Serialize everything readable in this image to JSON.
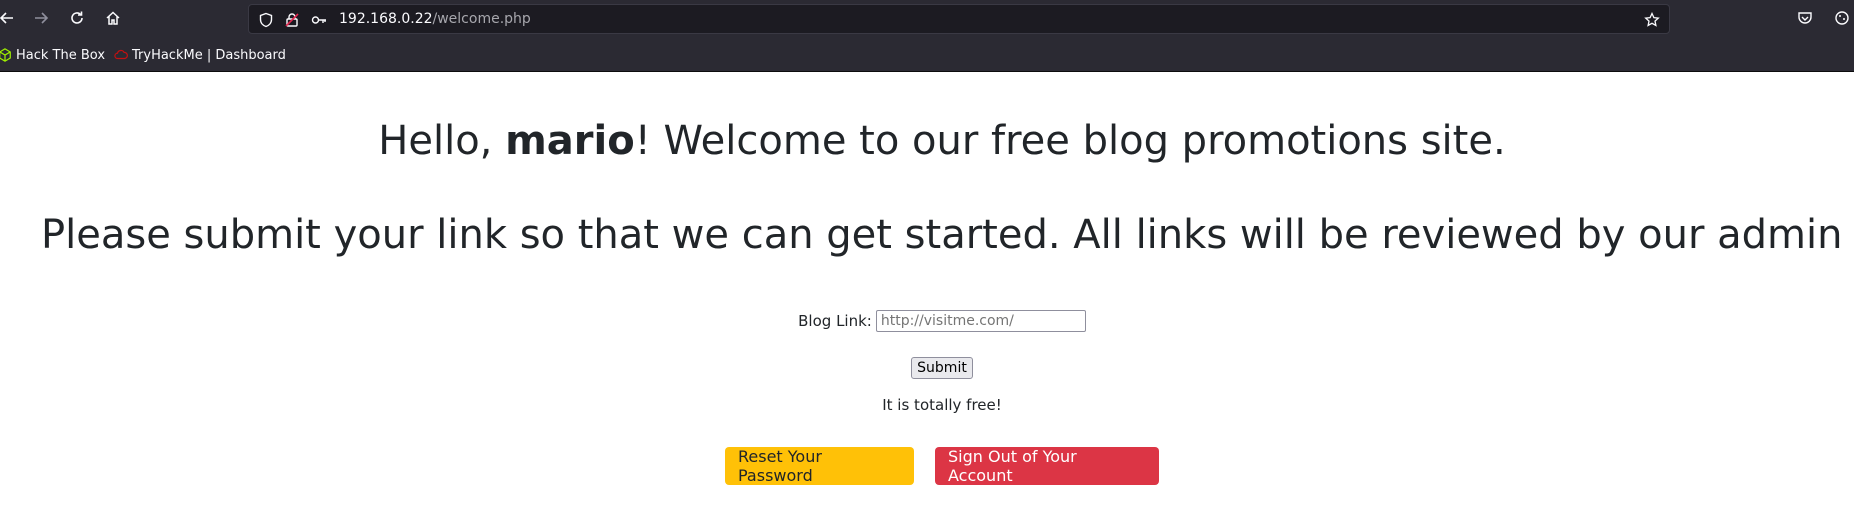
{
  "browser": {
    "url_host": "192.168.0.22",
    "url_path": "/welcome.php",
    "bookmarks": [
      {
        "label": "Hack The Box",
        "icon": "cube-icon",
        "color": "#9fef00"
      },
      {
        "label": "TryHackMe | Dashboard",
        "icon": "cloud-icon",
        "color": "#c11111"
      }
    ]
  },
  "page": {
    "greeting_prefix": "Hello, ",
    "username": "mario",
    "greeting_suffix": "! Welcome to our free blog promotions site.",
    "instructions": "Please submit your link so that we can get started. All links will be reviewed by our admin",
    "form": {
      "label": "Blog Link:",
      "placeholder": "http://visitme.com/",
      "value": "",
      "submit_label": "Submit"
    },
    "free_note": "It is totally free!",
    "reset_button": "Reset Your Password",
    "signout_button": "Sign Out of Your Account"
  },
  "colors": {
    "warning": "#ffc107",
    "danger": "#dc3545",
    "chrome": "#2b2a33"
  }
}
